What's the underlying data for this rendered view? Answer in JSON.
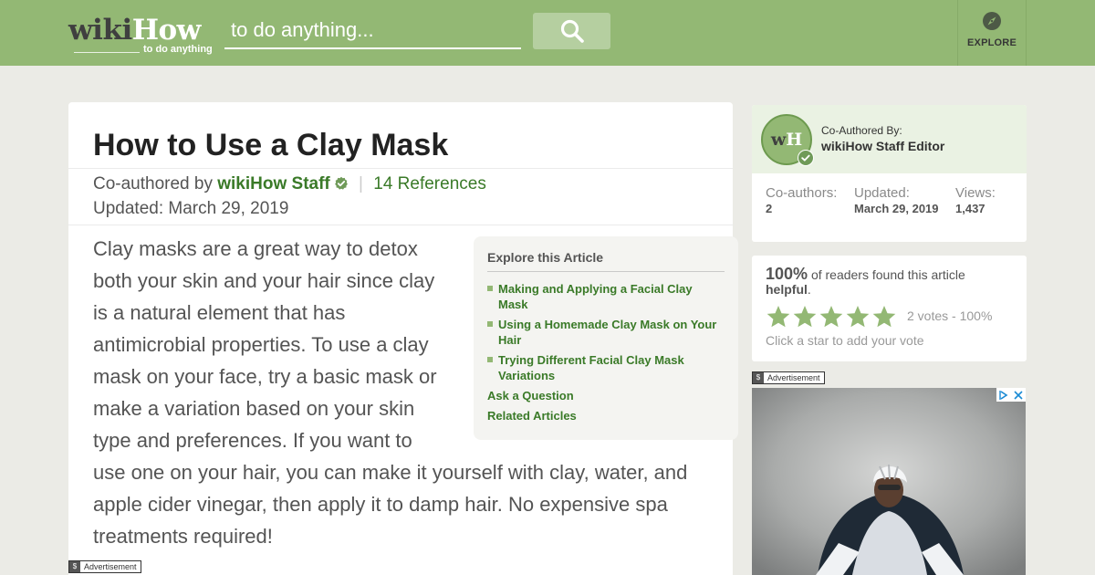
{
  "header": {
    "logo_wiki": "wiki",
    "logo_how": "How",
    "logo_tagline": "to do anything",
    "search_placeholder": "to do anything...",
    "explore_label": "EXPLORE"
  },
  "article": {
    "title": "How to Use a Clay Mask",
    "byline_prefix": "Co-authored by",
    "author": "wikiHow Staff",
    "separator": "|",
    "references": "14 References",
    "updated": "Updated: March 29, 2019",
    "intro": "Clay masks are a great way to detox both your skin and your hair since clay is a natural element that has antimicrobial properties. To use a clay mask on your face, try a basic mask or make a variation based on your skin type and preferences. If you want to use one on your hair, you can make it yourself with clay, water, and apple cider vinegar, then apply it to damp hair. No expensive spa treatments required!"
  },
  "toc": {
    "title": "Explore this Article",
    "items": [
      "Making and Applying a Facial Clay Mask",
      "Using a Homemade Clay Mask on Your Hair",
      "Trying Different Facial Clay Mask Variations"
    ],
    "links": [
      "Ask a Question",
      "Related Articles"
    ]
  },
  "advertisement_label": "Advertisement",
  "ad_dollar": "$",
  "coauthor_card": {
    "avatar_w": "w",
    "avatar_h": "H",
    "label": "Co-Authored By:",
    "name": "wikiHow Staff Editor",
    "stats": [
      {
        "label": "Co-authors:",
        "value": "2"
      },
      {
        "label": "Updated:",
        "value": "March 29, 2019"
      },
      {
        "label": "Views:",
        "value": "1,437"
      }
    ]
  },
  "helpful_card": {
    "percent": "100%",
    "text_before": "of readers found this article",
    "text_bold": "helpful",
    "text_after": ".",
    "rating_stars": 5,
    "votes": "2 votes - 100%",
    "hint": "Click a star to add your vote"
  },
  "colors": {
    "brand_green": "#93b874",
    "link_green": "#3a7a28",
    "background": "#ebebe6"
  }
}
